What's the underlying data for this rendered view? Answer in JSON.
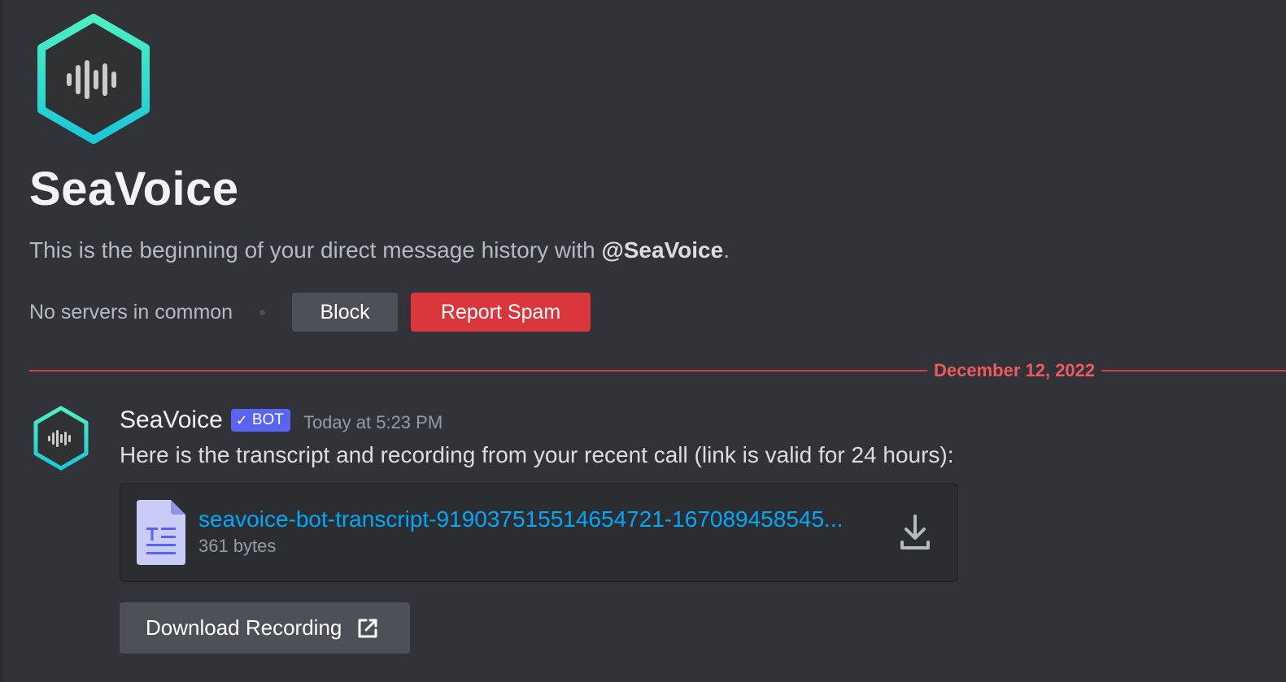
{
  "profile": {
    "name": "SeaVoice",
    "intro_prefix": "This is the beginning of your direct message history with ",
    "intro_mention": "@SeaVoice",
    "intro_suffix": ".",
    "no_servers": "No servers in common",
    "block_label": "Block",
    "report_label": "Report Spam",
    "avatar_icon": "soundwave-hexagon-icon"
  },
  "divider": {
    "date": "December 12, 2022"
  },
  "message": {
    "username": "SeaVoice",
    "badge": "BOT",
    "timestamp": "Today at 5:23 PM",
    "content": "Here is the transcript and recording from your recent call (link is valid for 24 hours):",
    "attachment": {
      "file_name": "seavoice-bot-transcript-919037515514654721-167089458545...",
      "file_size": "361 bytes",
      "file_icon": "text-file-icon",
      "download_icon": "download-icon"
    },
    "button_label": "Download Recording",
    "button_icon": "external-link-icon"
  },
  "colors": {
    "background": "#313338",
    "accent_teal": "#2ee6c2",
    "report_red": "#da373c",
    "divider_red": "#ed5a60",
    "link_blue": "#00a8fc",
    "bot_badge": "#5865f2"
  }
}
